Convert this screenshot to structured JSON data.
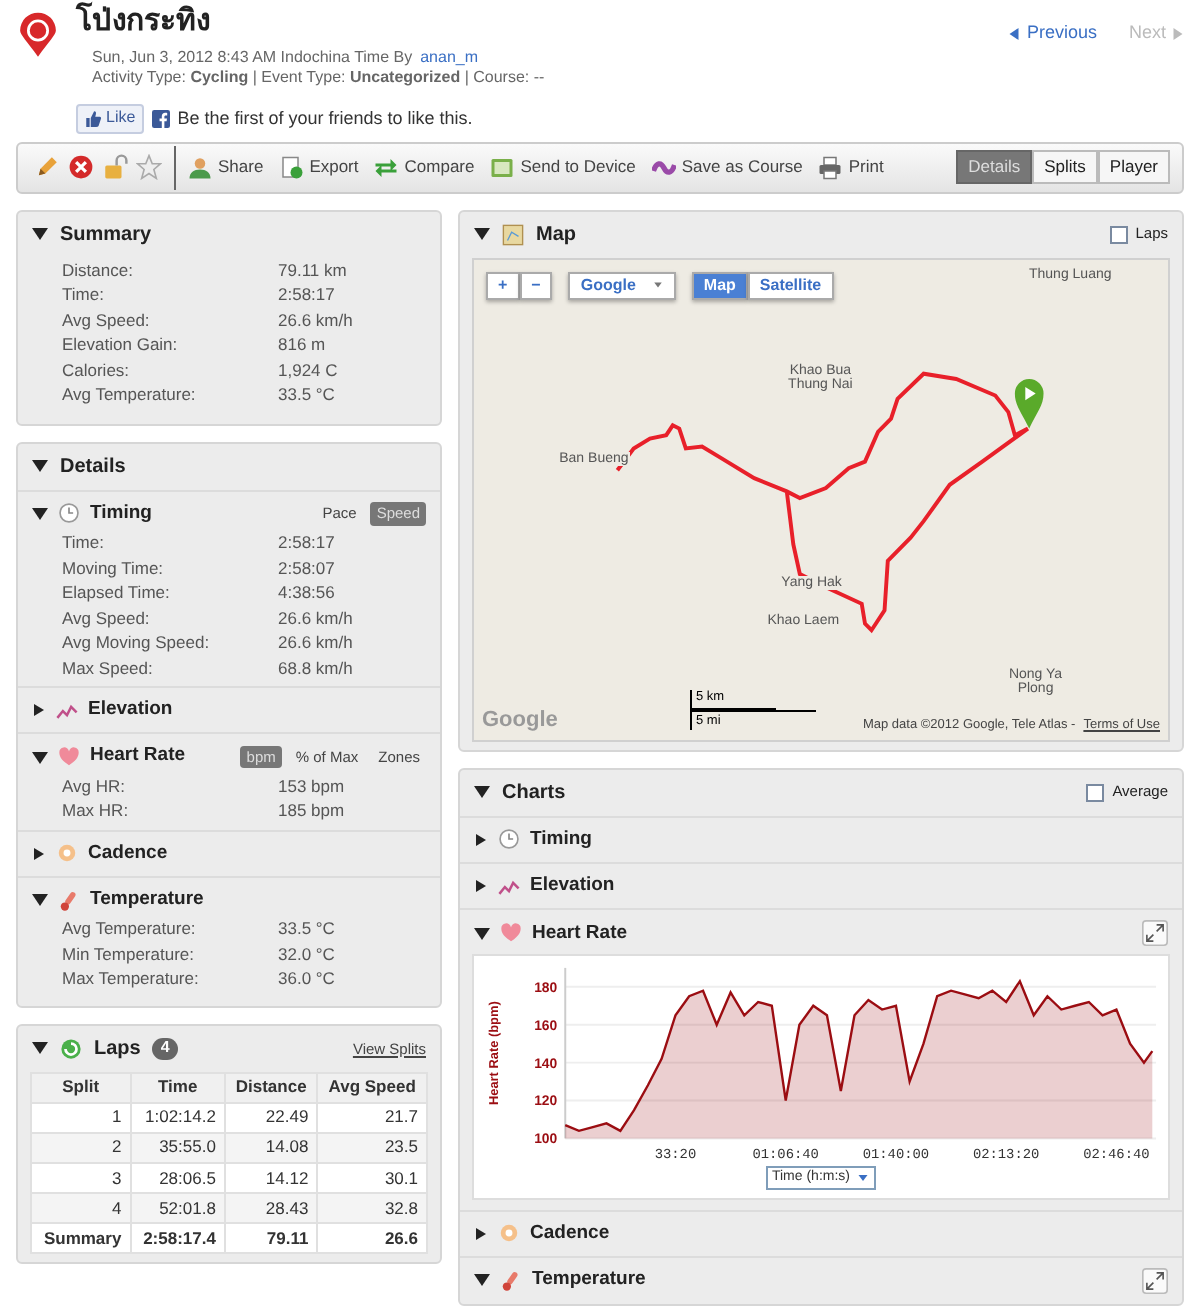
{
  "activity": {
    "title": "โป่งกระทิง",
    "date_line": "Sun, Jun 3, 2012 8:43 AM Indochina Time By",
    "author": "anan_m",
    "meta": "Activity Type: **Cycling** | Event Type: **Uncategorized** | Course: --"
  },
  "like": {
    "button": "Like",
    "text": "Be the first of your friends to like this."
  },
  "pager": [
    {
      "label": "Previous",
      "disabled": false
    },
    {
      "label": "Next",
      "disabled": true
    }
  ],
  "toolbar": {
    "actions": [
      "Share",
      "Export",
      "Compare",
      "Send to Device",
      "Save as Course",
      "Print"
    ],
    "views": [
      {
        "label": "Details",
        "selected": true
      },
      {
        "label": "Splits",
        "selected": false
      },
      {
        "label": "Player",
        "selected": false
      }
    ]
  },
  "summary": {
    "title": "Summary",
    "expanded": true,
    "rows": [
      {
        "label": "Distance:",
        "value": "79.11 km"
      },
      {
        "label": "Time:",
        "value": "2:58:17"
      },
      {
        "label": "Avg Speed:",
        "value": "26.6 km/h"
      },
      {
        "label": "Elevation Gain:",
        "value": "816 m"
      },
      {
        "label": "Calories:",
        "value": "1,924 C"
      },
      {
        "label": "Avg Temperature:",
        "value": "33.5 °C"
      }
    ]
  },
  "details": {
    "title": "Details",
    "expanded": true,
    "sections": [
      {
        "kind": "timing",
        "title": "Timing",
        "expanded": true,
        "units": [
          {
            "label": "Pace",
            "selected": false
          },
          {
            "label": "Speed",
            "selected": true
          }
        ],
        "rows": [
          {
            "label": "Time:",
            "value": "2:58:17"
          },
          {
            "label": "Moving Time:",
            "value": "2:58:07"
          },
          {
            "label": "Elapsed Time:",
            "value": "4:38:56"
          },
          {
            "label": "Avg Speed:",
            "value": "26.6 km/h"
          },
          {
            "label": "Avg Moving Speed:",
            "value": "26.6 km/h"
          },
          {
            "label": "Max Speed:",
            "value": "68.8 km/h"
          }
        ]
      },
      {
        "kind": "elevation",
        "title": "Elevation",
        "expanded": false
      },
      {
        "kind": "heart",
        "title": "Heart Rate",
        "expanded": true,
        "units": [
          {
            "label": "bpm",
            "selected": true
          },
          {
            "label": "% of Max",
            "selected": false
          },
          {
            "label": "Zones",
            "selected": false
          }
        ],
        "rows": [
          {
            "label": "Avg HR:",
            "value": "153 bpm"
          },
          {
            "label": "Max HR:",
            "value": "185 bpm"
          }
        ]
      },
      {
        "kind": "cadence",
        "title": "Cadence",
        "expanded": false
      },
      {
        "kind": "temperature",
        "title": "Temperature",
        "expanded": true,
        "rows": [
          {
            "label": "Avg Temperature:",
            "value": "33.5 °C"
          },
          {
            "label": "Min Temperature:",
            "value": "32.0 °C"
          },
          {
            "label": "Max Temperature:",
            "value": "36.0 °C"
          }
        ]
      }
    ]
  },
  "laps": {
    "title": "Laps",
    "expanded": true,
    "count": "4",
    "link": "View Splits",
    "columns": [
      "Split",
      "Time",
      "Distance",
      "Avg Speed"
    ],
    "rows": [
      [
        "1",
        "1:02:14.2",
        "22.49",
        "21.7"
      ],
      [
        "2",
        "35:55.0",
        "14.08",
        "23.5"
      ],
      [
        "3",
        "28:06.5",
        "14.12",
        "30.1"
      ],
      [
        "4",
        "52:01.8",
        "28.43",
        "32.8"
      ]
    ],
    "summary": [
      "Summary",
      "2:58:17.4",
      "79.11",
      "26.6"
    ]
  },
  "map": {
    "title": "Map",
    "expanded": true,
    "laps_checkbox": {
      "label": "Laps",
      "checked": false
    },
    "zoom_buttons": [
      "+",
      "−"
    ],
    "provider": "Google",
    "types": [
      {
        "label": "Map",
        "selected": true
      },
      {
        "label": "Satellite",
        "selected": false
      }
    ],
    "places": [
      "Thung Luang",
      "Khao Bua Thung Nai",
      "Ban Bueng",
      "Yang Hak",
      "Khao Laem",
      "Nong Ya Plong"
    ],
    "logo": "Google",
    "scale": [
      "5 km",
      "5 mi"
    ],
    "attribution": "Map data ©2012 Google, Tele Atlas -",
    "terms": "Terms of Use"
  },
  "charts": {
    "title": "Charts",
    "expanded": true,
    "average": {
      "label": "Average",
      "checked": false
    },
    "sections": [
      {
        "kind": "timing",
        "title": "Timing",
        "expanded": false
      },
      {
        "kind": "elevation",
        "title": "Elevation",
        "expanded": false
      },
      {
        "kind": "heart",
        "title": "Heart Rate",
        "expanded": true,
        "chart_data": {
          "type": "area",
          "xlabel": "Time (h:m:s)",
          "ylabel": "Heart Rate (bpm)",
          "x": [
            0,
            250,
            500,
            750,
            1000,
            1250,
            1500,
            1750,
            2000,
            2250,
            2500,
            2750,
            3000,
            3250,
            3500,
            3750,
            4000,
            4250,
            4500,
            4750,
            5000,
            5250,
            5500,
            5750,
            6000,
            6250,
            6500,
            6750,
            7000,
            7250,
            7500,
            7750,
            8000,
            8250,
            8500,
            8750,
            9000,
            9250,
            9500,
            9750,
            10000,
            10250,
            10500,
            10650
          ],
          "grid": true,
          "series": [
            {
              "color": "#9b0d12",
              "values": [
                107,
                104,
                106,
                108,
                104,
                115,
                128,
                142,
                165,
                175,
                178,
                160,
                177,
                165,
                172,
                170,
                120,
                160,
                170,
                165,
                125,
                165,
                173,
                168,
                170,
                130,
                150,
                175,
                178,
                176,
                174,
                178,
                172,
                183,
                165,
                175,
                168,
                170,
                172,
                165,
                168,
                150,
                140,
                146
              ]
            }
          ],
          "xlim": [
            0,
            10720
          ],
          "ylim": [
            100,
            190
          ],
          "yticks": [
            100,
            120,
            140,
            160,
            180
          ],
          "xticks": [
            {
              "value": 2000,
              "label": "33:20"
            },
            {
              "value": 4000,
              "label": "01:06:40"
            },
            {
              "value": 6000,
              "label": "01:40:00"
            },
            {
              "value": 8000,
              "label": "02:13:20"
            },
            {
              "value": 10000,
              "label": "02:46:40"
            }
          ]
        }
      },
      {
        "kind": "cadence",
        "title": "Cadence",
        "expanded": false
      },
      {
        "kind": "temperature",
        "title": "Temperature",
        "expanded": true
      }
    ]
  }
}
